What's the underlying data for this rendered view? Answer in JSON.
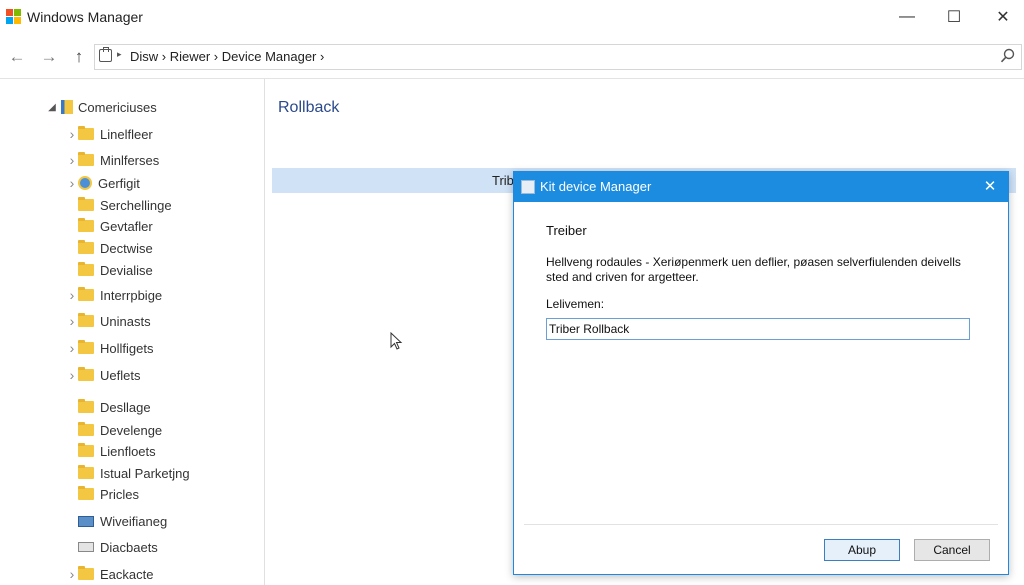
{
  "window": {
    "title": "Windows Manager",
    "minimize_glyph": "—",
    "maximize_glyph": "☐",
    "close_glyph": "✕"
  },
  "nav": {
    "back_glyph": "←",
    "forward_glyph": "→",
    "up_glyph": "↑",
    "address_chevron": "▸",
    "address_path": "Disw › Riewer › Device Manager ›"
  },
  "tree": {
    "root_label": "Comericiuses",
    "items": [
      {
        "label": "Linelfleer",
        "expandable": true
      },
      {
        "label": "Minlferses",
        "expandable": true
      },
      {
        "label": "Gerfigit",
        "expandable": true,
        "icon": "settings-icon"
      },
      {
        "label": "Serchellinge",
        "expandable": false
      },
      {
        "label": "Gevtafler",
        "expandable": false
      },
      {
        "label": "Dectwise",
        "expandable": false
      },
      {
        "label": "Devialise",
        "expandable": false
      },
      {
        "label": "Interrpbige",
        "expandable": true
      },
      {
        "label": "Uninasts",
        "expandable": true
      },
      {
        "label": "Hollfigets",
        "expandable": true
      },
      {
        "label": "Ueflets",
        "expandable": true
      },
      {
        "label": "Desllage",
        "expandable": false
      },
      {
        "label": "Develenge",
        "expandable": false
      },
      {
        "label": "Lienfloets",
        "expandable": false
      },
      {
        "label": "Istual Parketjng",
        "expandable": false
      },
      {
        "label": "Pricles",
        "expandable": false
      },
      {
        "label": "Wiveifianeg",
        "expandable": false,
        "icon": "monitor-icon"
      },
      {
        "label": "Diacbaets",
        "expandable": false,
        "icon": "drive-icon"
      },
      {
        "label": "Eackacte",
        "expandable": true
      }
    ]
  },
  "content": {
    "heading": "Rollback",
    "selected_row_text": "Trib"
  },
  "dialog": {
    "title": "Kit device Manager",
    "close_glyph": "✕",
    "heading": "Treiber",
    "description": "Hellveng rodaules - Xeriøpenmerk uen deflier, pøasen selverfiulenden deivells sted and criven for argetteer.",
    "field_label": "Lelivemen:",
    "field_value": "Triber Rollback",
    "ok_label": "Abup",
    "cancel_label": "Cancel"
  },
  "colors": {
    "accent": "#1b8ce0",
    "selection": "#cfe2f6",
    "heading_blue": "#2b4a8c",
    "folder": "#f4c742"
  }
}
